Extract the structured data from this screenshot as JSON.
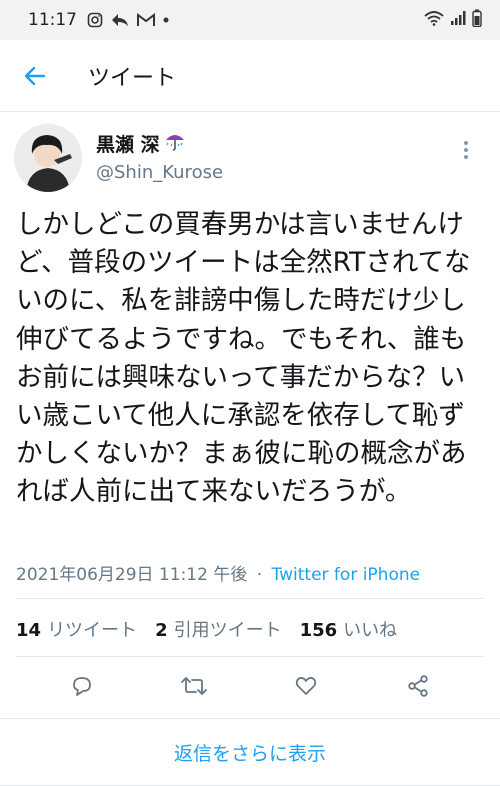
{
  "status_bar": {
    "time": "11:17"
  },
  "header": {
    "title": "ツイート"
  },
  "tweet": {
    "user": {
      "display_name": "黒瀬 深",
      "handle": "@Shin_Kurose"
    },
    "text": "しかしどこの買春男かは言いませんけど、普段のツイートは全然RTされてないのに、私を誹謗中傷した時だけ少し伸びてるようですね。でもそれ、誰もお前には興味ないって事だからな？いい歳こいて他人に承認を依存して恥ずかしくないか？まぁ彼に恥の概念があれば人前に出て来ないだろうが。",
    "timestamp": "2021年06月29日 11:12 午後",
    "separator": "·",
    "source": "Twitter for iPhone",
    "stats": {
      "retweets_count": "14",
      "retweets_label": "リツイート",
      "quotes_count": "2",
      "quotes_label": "引用ツイート",
      "likes_count": "156",
      "likes_label": "いいね"
    }
  },
  "more_replies": {
    "label": "返信をさらに表示"
  },
  "colors": {
    "accent": "#1da1f2",
    "secondary_text": "#657786",
    "primary_text": "#14171a"
  }
}
